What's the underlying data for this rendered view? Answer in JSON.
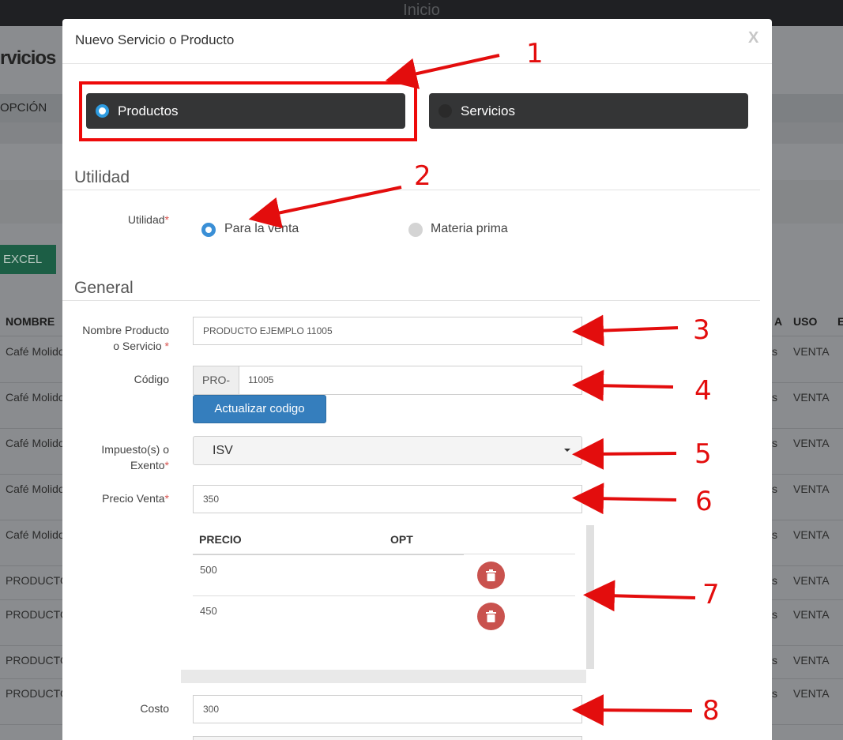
{
  "background": {
    "topbar_title": "Inicio",
    "page_title": "rvicios",
    "option_label": "OPCIÓN",
    "excel_button": "EXCEL",
    "table": {
      "headers": [
        "NOMBRE",
        "A",
        "USO",
        "E"
      ],
      "rows": [
        {
          "name": "Café Molido",
          "mid": "s",
          "uso": "VENTA"
        },
        {
          "name": "Café Molido",
          "mid": "s",
          "uso": "VENTA"
        },
        {
          "name": "Café Molido",
          "mid": "s",
          "uso": "VENTA"
        },
        {
          "name": "Café Molido",
          "mid": "s",
          "uso": "VENTA"
        },
        {
          "name": "Café Molido",
          "mid": "s",
          "uso": "VENTA"
        },
        {
          "name": "PRODUCTO",
          "mid": "s",
          "uso": "VENTA"
        },
        {
          "name": "PRODUCTO",
          "mid": "s",
          "uso": "VENTA"
        },
        {
          "name": "PRODUCTO",
          "mid": "s",
          "uso": "VENTA"
        },
        {
          "name": "PRODUCTO",
          "mid": "s",
          "uso": "VENTA"
        }
      ]
    }
  },
  "modal": {
    "title": "Nuevo Servicio o Producto",
    "close": "X",
    "type_options": [
      {
        "label": "Productos",
        "selected": true
      },
      {
        "label": "Servicios",
        "selected": false
      }
    ],
    "utilidad": {
      "section_title": "Utilidad",
      "label": "Utilidad",
      "required_mark": "*",
      "options": [
        {
          "label": "Para la venta",
          "selected": true
        },
        {
          "label": "Materia prima",
          "selected": false
        }
      ]
    },
    "general": {
      "section_title": "General",
      "nombre_label_line1": "Nombre Producto",
      "nombre_label_line2": "o Servicio",
      "nombre_value": "PRODUCTO EJEMPLO 11005",
      "codigo_label": "Código",
      "codigo_prefix": "PRO-",
      "codigo_value": "11005",
      "actualizar_button": "Actualizar codigo",
      "impuesto_label_line1": "Impuesto(s) o",
      "impuesto_label_line2": "Exento",
      "impuesto_value": "ISV",
      "precio_label": "Precio Venta",
      "precio_value": "350",
      "precios_table": {
        "headers": [
          "PRECIO",
          "OPT"
        ],
        "rows": [
          {
            "precio": "500",
            "opt": ""
          },
          {
            "precio": "450",
            "opt": ""
          }
        ]
      },
      "costo_label": "Costo",
      "costo_value": "300",
      "required_mark": "*"
    }
  },
  "annotations": {
    "color": "#e30d0d",
    "numbers": [
      "1",
      "2",
      "3",
      "4",
      "5",
      "6",
      "7",
      "8"
    ]
  }
}
